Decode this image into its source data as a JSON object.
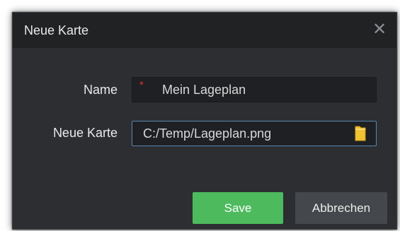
{
  "dialog": {
    "title": "Neue Karte",
    "close_glyph": "✕"
  },
  "form": {
    "name_label": "Name",
    "name_required_marker": "*",
    "name_value": "Mein Lageplan",
    "map_label": "Neue Karte",
    "map_value": "C:/Temp/Lageplan.png",
    "map_browse_icon": "folder-icon"
  },
  "buttons": {
    "save_label": "Save",
    "cancel_label": "Abbrechen"
  },
  "colors": {
    "dialog_bg": "#2c2e31",
    "titlebar_bg": "#202224",
    "input_bg": "#1e2023",
    "focus_border": "#5b86b6",
    "required": "#e23232",
    "save_button": "#4dba5d",
    "cancel_button": "#44474b",
    "folder": "#f1c232"
  }
}
